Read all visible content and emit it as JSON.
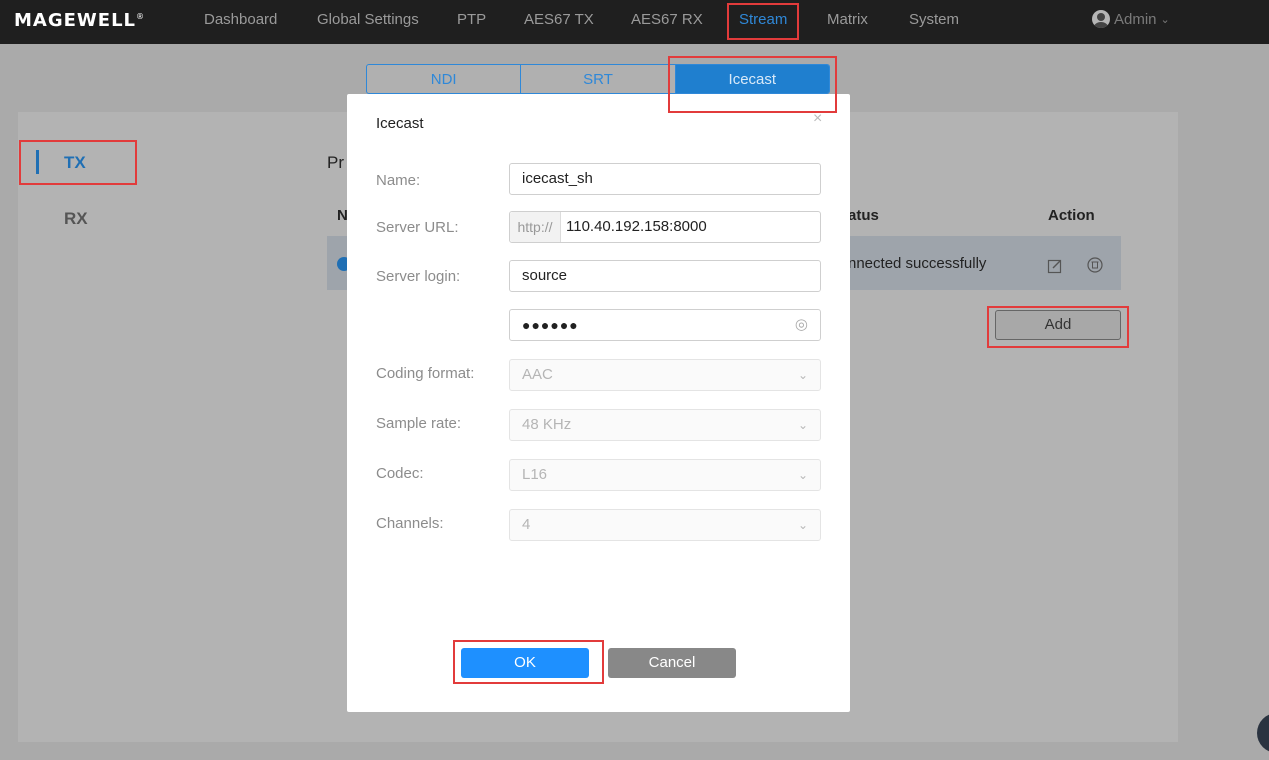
{
  "app": {
    "logo": "MAGEWELL",
    "logo_mark": "®"
  },
  "nav": {
    "items": [
      "Dashboard",
      "Global Settings",
      "PTP",
      "AES67 TX",
      "AES67 RX",
      "Stream",
      "Matrix",
      "System"
    ],
    "active": "Stream",
    "user": "Admin"
  },
  "tabs": {
    "items": [
      "NDI",
      "SRT",
      "Icecast"
    ],
    "active": "Icecast"
  },
  "sidebar": {
    "items": [
      "TX",
      "RX"
    ],
    "active": "TX"
  },
  "background": {
    "section_fragment": "Pr",
    "col_name_fragment": "N",
    "col_status_fragment": "atus",
    "col_action": "Action",
    "row_status_fragment": "nnected successfully",
    "add_label": "Add"
  },
  "modal": {
    "title": "Icecast",
    "close": "×",
    "fields": {
      "name": {
        "label": "Name:",
        "value": "icecast_sh"
      },
      "server_url": {
        "label": "Server URL:",
        "prefix": "http://",
        "value": "110.40.192.158:8000"
      },
      "server_login": {
        "label": "Server login:",
        "value": "source"
      },
      "password": {
        "value": "●●●●●●"
      },
      "coding_format": {
        "label": "Coding format:",
        "value": "AAC"
      },
      "sample_rate": {
        "label": "Sample rate:",
        "value": "48 KHz"
      },
      "codec": {
        "label": "Codec:",
        "value": "L16"
      },
      "channels": {
        "label": "Channels:",
        "value": "4"
      }
    },
    "ok_label": "OK",
    "cancel_label": "Cancel"
  },
  "colors": {
    "accent": "#1e90ff",
    "annotation": "#e23b3b",
    "topbar": "#1f1f1f"
  }
}
